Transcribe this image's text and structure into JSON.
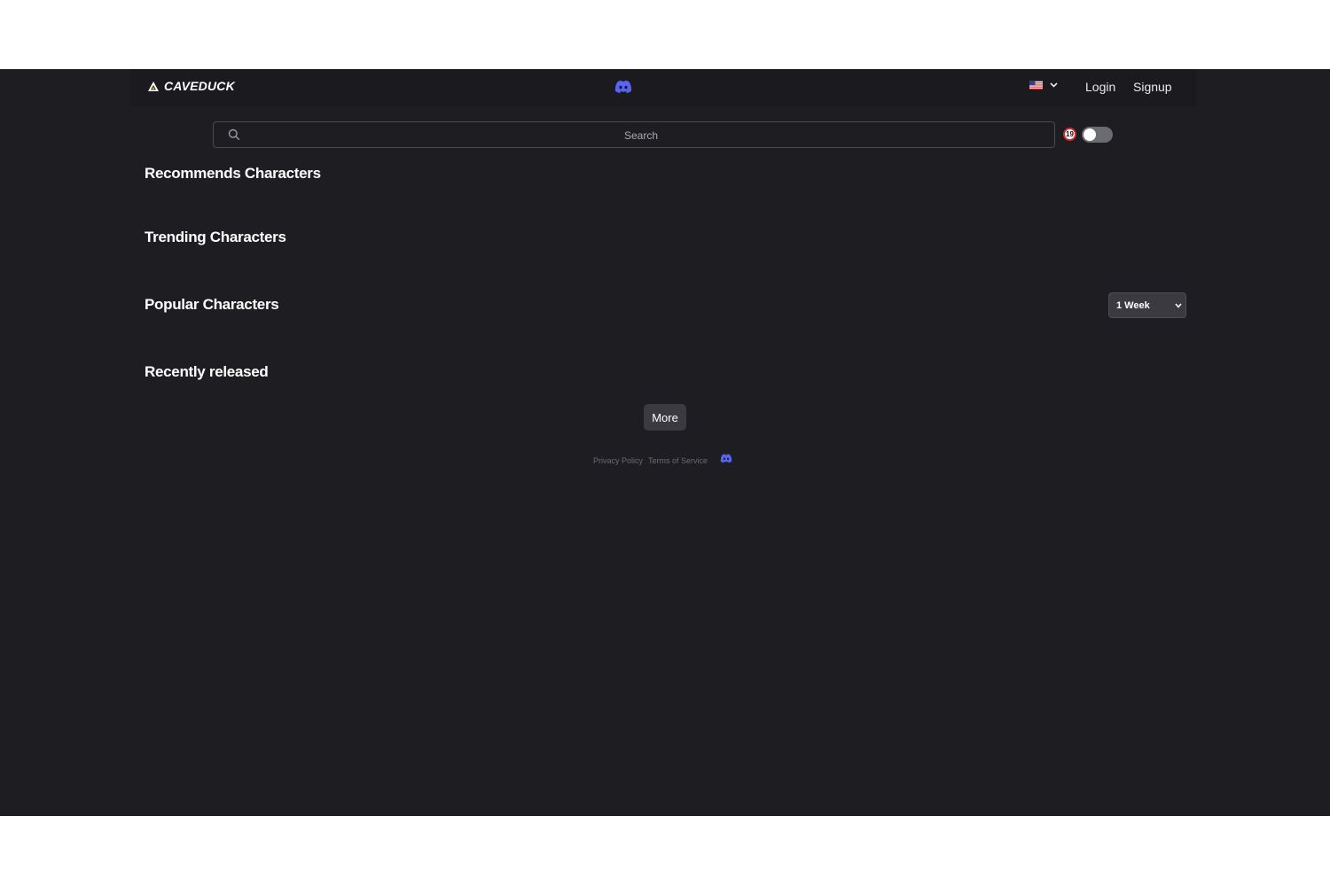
{
  "header": {
    "logo_text": "CAVEDUCK",
    "logo_icon": "triangle-logo-icon",
    "discord_icon": "discord-icon",
    "language_flag": "us-flag-icon",
    "login_label": "Login",
    "signup_label": "Signup"
  },
  "search": {
    "placeholder": "Search",
    "age_badge": "19",
    "adult_toggle_on": false
  },
  "sections": {
    "recommends": "Recommends Characters",
    "trending": "Trending Characters",
    "popular": "Popular Characters",
    "recent": "Recently released"
  },
  "popular_period": {
    "selected": "1 Week"
  },
  "more_label": "More",
  "footer": {
    "privacy": "Privacy Policy",
    "terms": "Terms of Service"
  },
  "colors": {
    "background": "#1e1d21",
    "discord": "#5865f2",
    "button": "#3a3a40"
  }
}
